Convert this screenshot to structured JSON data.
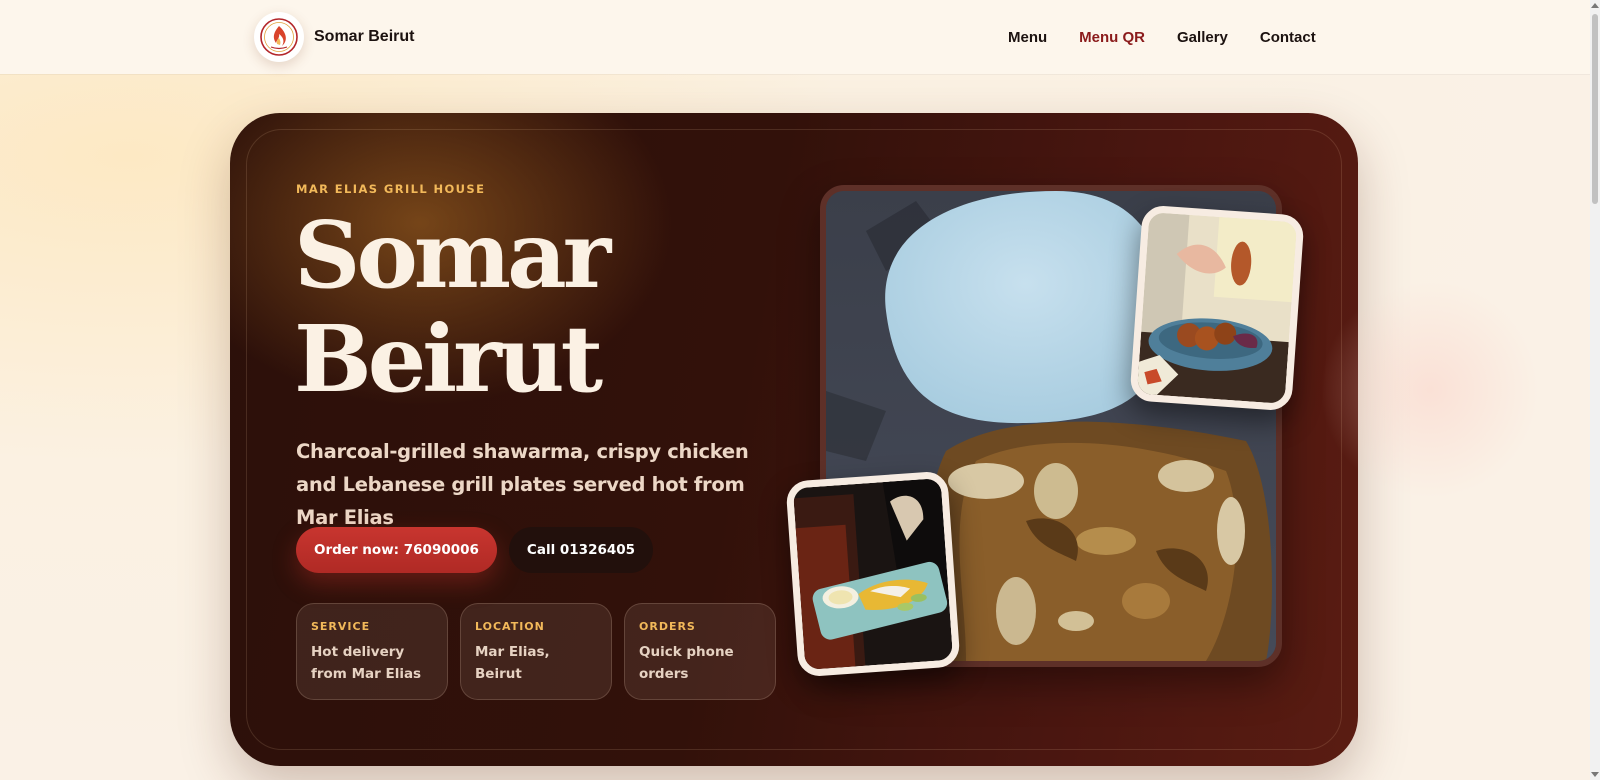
{
  "header": {
    "brand_name": "Somar Beirut",
    "logo_icon": "somar-beirut-logo",
    "nav": [
      {
        "label": "Menu",
        "active": false
      },
      {
        "label": "Menu QR",
        "active": true
      },
      {
        "label": "Gallery",
        "active": false
      },
      {
        "label": "Contact",
        "active": false
      }
    ]
  },
  "hero": {
    "eyebrow": "MAR ELIAS GRILL HOUSE",
    "title_line1": "Somar",
    "title_line2": "Beirut",
    "description": "Charcoal-grilled shawarma, crispy chicken and Lebanese grill plates served hot from Mar Elias",
    "primary_button": "Order now: 76090006",
    "secondary_button": "Call 01326405",
    "info_cards": [
      {
        "label": "SERVICE",
        "value": "Hot delivery from Mar Elias"
      },
      {
        "label": "LOCATION",
        "value": "Mar Elias, Beirut"
      },
      {
        "label": "ORDERS",
        "value": "Quick phone orders"
      }
    ],
    "photos": {
      "main": "shawarma-grill-photo",
      "top": "kibbeh-plate-photo",
      "bottom": "rice-platter-photo"
    }
  },
  "colors": {
    "accent": "#c8352f",
    "active_nav": "#8b1b1b",
    "gold": "#f2b95a",
    "hero_bg": "#32110a",
    "cream": "#fbf1e4"
  }
}
